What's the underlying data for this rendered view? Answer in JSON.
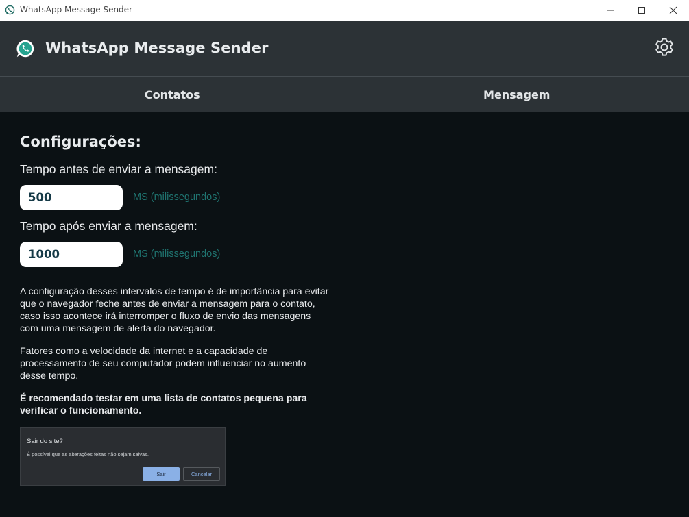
{
  "window": {
    "title": "WhatsApp Message Sender",
    "icon": "whatsapp-icon"
  },
  "header": {
    "title": "WhatsApp Message Sender",
    "logo_icon": "whatsapp-icon",
    "settings_icon": "gear-icon"
  },
  "tabs": [
    {
      "label": "Contatos"
    },
    {
      "label": "Mensagem"
    }
  ],
  "config": {
    "heading": "Configurações:",
    "before_label": "Tempo antes de enviar a mensagem:",
    "before_value": "500",
    "before_unit": "MS (milissegundos)",
    "after_label": "Tempo após enviar a mensagem:",
    "after_value": "1000",
    "after_unit": "MS (milissegundos)",
    "paragraph1": "A configuração desses intervalos de tempo é de importância para evitar que o navegador feche antes de enviar a mensagem para o contato, caso isso acontece irá interromper o fluxo de envio das mensagens com uma mensagem de alerta do navegador.",
    "paragraph2": "Fatores como a velocidade da internet e a capacidade de processamento de seu computador podem influenciar no aumento desse tempo.",
    "paragraph3": "É recomendado testar em uma lista de contatos pequena para verificar o funcionamento."
  },
  "example_dialog": {
    "title": "Sair do site?",
    "message": "É possível que as alterações feitas não sejam salvas.",
    "leave_label": "Sair",
    "cancel_label": "Cancelar"
  },
  "colors": {
    "header_bg": "#2c3236",
    "body_bg": "#0b1114",
    "unit_text": "#1f7470",
    "input_text": "#163a47"
  }
}
